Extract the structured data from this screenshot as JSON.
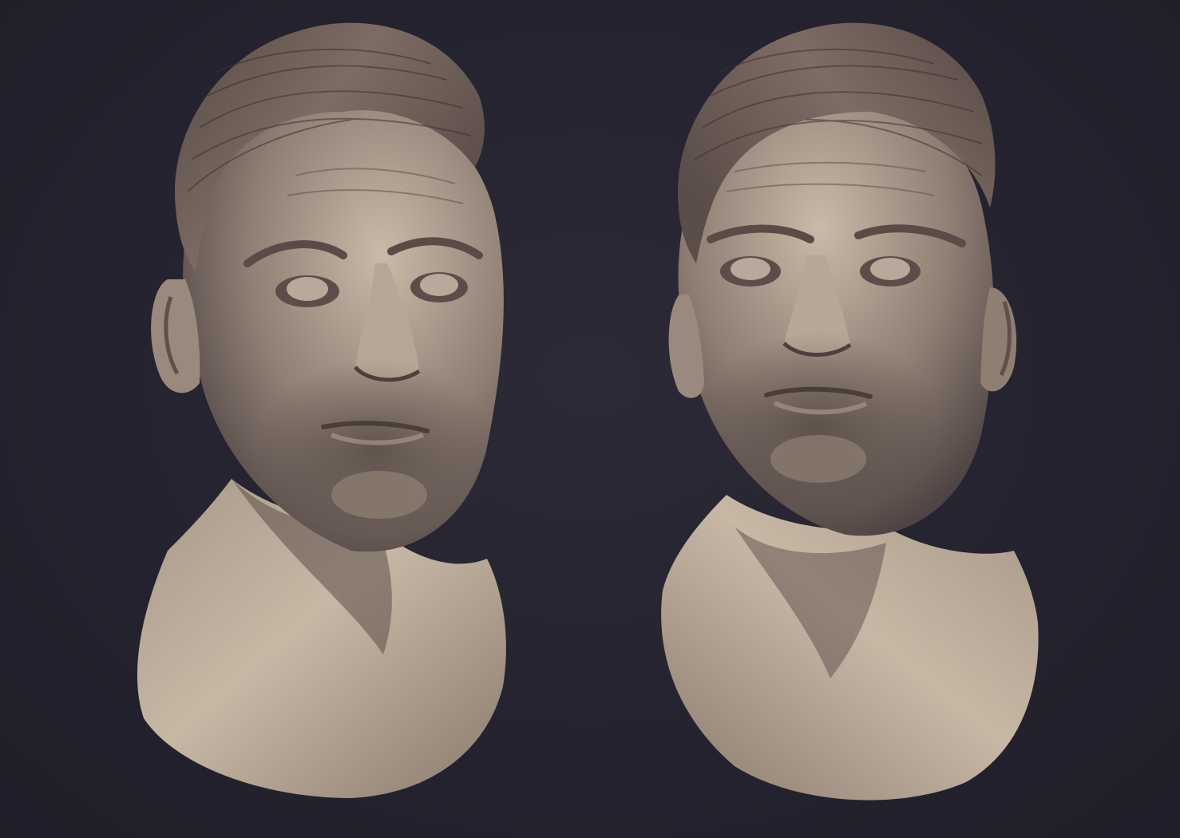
{
  "scene": {
    "background_color": "#25232f",
    "material": {
      "clay_light": "#c8b9a8",
      "clay_mid": "#9c8b7c",
      "clay_dark": "#4e4240",
      "hair": "#6d5d58",
      "stubble": "#3b322f"
    }
  },
  "sculpt_views": [
    {
      "view": "three-quarter-left",
      "label": ""
    },
    {
      "view": "three-quarter-right-up",
      "label": ""
    }
  ]
}
